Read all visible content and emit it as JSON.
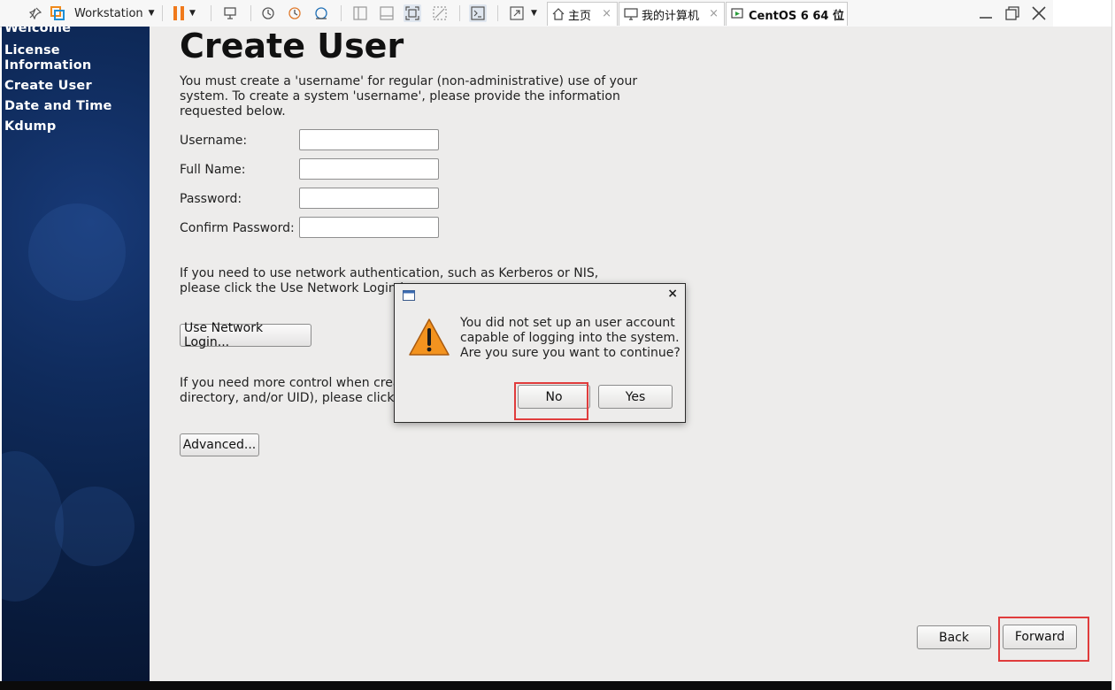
{
  "toolbar": {
    "app_name": "Workstation",
    "tabs": [
      {
        "label": "主页",
        "icon": "home-icon"
      },
      {
        "label": "我的计算机",
        "icon": "computer-icon"
      },
      {
        "label": "CentOS 6 64 位",
        "icon": "vm-icon"
      }
    ],
    "close_glyph": "×"
  },
  "sidebar": {
    "items": [
      {
        "label": "Welcome"
      },
      {
        "label": "License\nInformation"
      },
      {
        "label": "Create User"
      },
      {
        "label": "Date and Time"
      },
      {
        "label": "Kdump"
      }
    ]
  },
  "main": {
    "title": "Create User",
    "intro": "You must create a 'username' for regular (non-administrative) use of your\nsystem.  To create a system 'username', please provide the information\nrequested below.",
    "fields": [
      {
        "label": "Username:",
        "value": ""
      },
      {
        "label": "Full Name:",
        "value": ""
      },
      {
        "label": "Password:",
        "value": ""
      },
      {
        "label": "Confirm Password:",
        "value": ""
      }
    ],
    "network_text": "If you need to use network authentication, such as Kerberos or NIS,\nplease click the Use Network Login b",
    "network_button": "Use Network Login...",
    "advanced_text": "If you need more control when crea\ndirectory, and/or UID), please click t",
    "advanced_button": "Advanced...",
    "back_button": "Back",
    "forward_button": "Forward"
  },
  "dialog": {
    "message": "You did not set up an user account\ncapable of logging into the system.\nAre you sure you want to continue?",
    "no_button": "No",
    "yes_button": "Yes",
    "close": "×"
  },
  "colors": {
    "highlight": "#e03c3c",
    "sidebar": "#0f2b5c",
    "content_bg": "#edeceb",
    "warning": "#f08a1c"
  }
}
